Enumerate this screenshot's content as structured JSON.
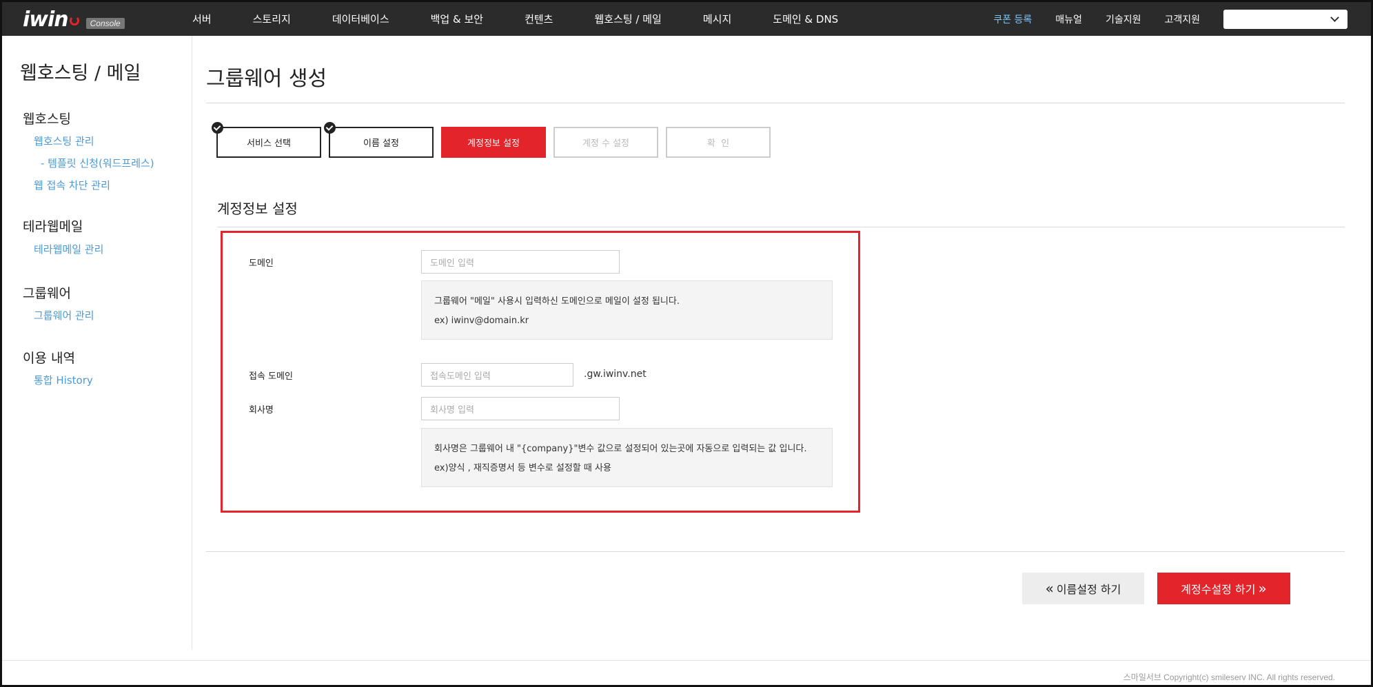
{
  "topbar": {
    "logo_text": "iwin",
    "logo_badge": "Console",
    "nav": [
      "서버",
      "스토리지",
      "데이터베이스",
      "백업 & 보안",
      "컨텐츠",
      "웹호스팅 / 메일",
      "메시지",
      "도메인 & DNS"
    ],
    "util": {
      "coupon": "쿠폰 등록",
      "manual": "매뉴얼",
      "tech_support": "기술지원",
      "customer_support": "고객지원",
      "select_value": ""
    },
    "colors": {
      "bar": "#2b2b2b",
      "coupon": "#7fc4f5",
      "accent": "#e3242b"
    }
  },
  "sidebar": {
    "title": "웹호스팅 / 메일",
    "groups": [
      {
        "title": "웹호스팅",
        "links": [
          "웹호스팅 관리",
          "- 템플릿 신청(워드프레스)",
          "웹 접속 차단 관리"
        ]
      },
      {
        "title": "테라웹메일",
        "links": [
          "테라웹메일 관리"
        ]
      },
      {
        "title": "그룹웨어",
        "links": [
          "그룹웨어 관리"
        ]
      },
      {
        "title": "이용 내역",
        "links": [
          "통합 History"
        ]
      }
    ]
  },
  "main": {
    "page_title": "그룹웨어 생성",
    "steps": [
      {
        "label": "서비스 선택",
        "state": "done"
      },
      {
        "label": "이름 설정",
        "state": "done"
      },
      {
        "label": "계정정보 설정",
        "state": "active"
      },
      {
        "label": "계정 수 설정",
        "state": "future"
      },
      {
        "label": "확  인",
        "state": "future"
      }
    ],
    "section_title": "계정정보 설정",
    "form": {
      "domain": {
        "label": "도메인",
        "placeholder": "도메인 입력",
        "value": "",
        "note_line1": "그룹웨어 \"메일\" 사용시 입력하신 도메인으로 메일이 설정 됩니다.",
        "note_line2": "ex) iwinv@domain.kr"
      },
      "access_domain": {
        "label": "접속 도메인",
        "placeholder": "접속도메인 입력",
        "value": "",
        "suffix": ".gw.iwinv.net"
      },
      "company": {
        "label": "회사명",
        "placeholder": "회사명 입력",
        "value": "",
        "note_line1": "회사명은 그룹웨어 내 \"{company}\"변수 값으로 설정되어 있는곳에 자동으로 입력되는 값 입니다.",
        "note_line2": "ex)양식 , 재직증명서 등 변수로 설정할 때 사용"
      }
    },
    "buttons": {
      "prev": "이름설정 하기",
      "next": "계정수설정 하기"
    }
  },
  "footer": {
    "copyright": "스마일서브 Copyright(c) smileserv INC. All rights reserved."
  }
}
